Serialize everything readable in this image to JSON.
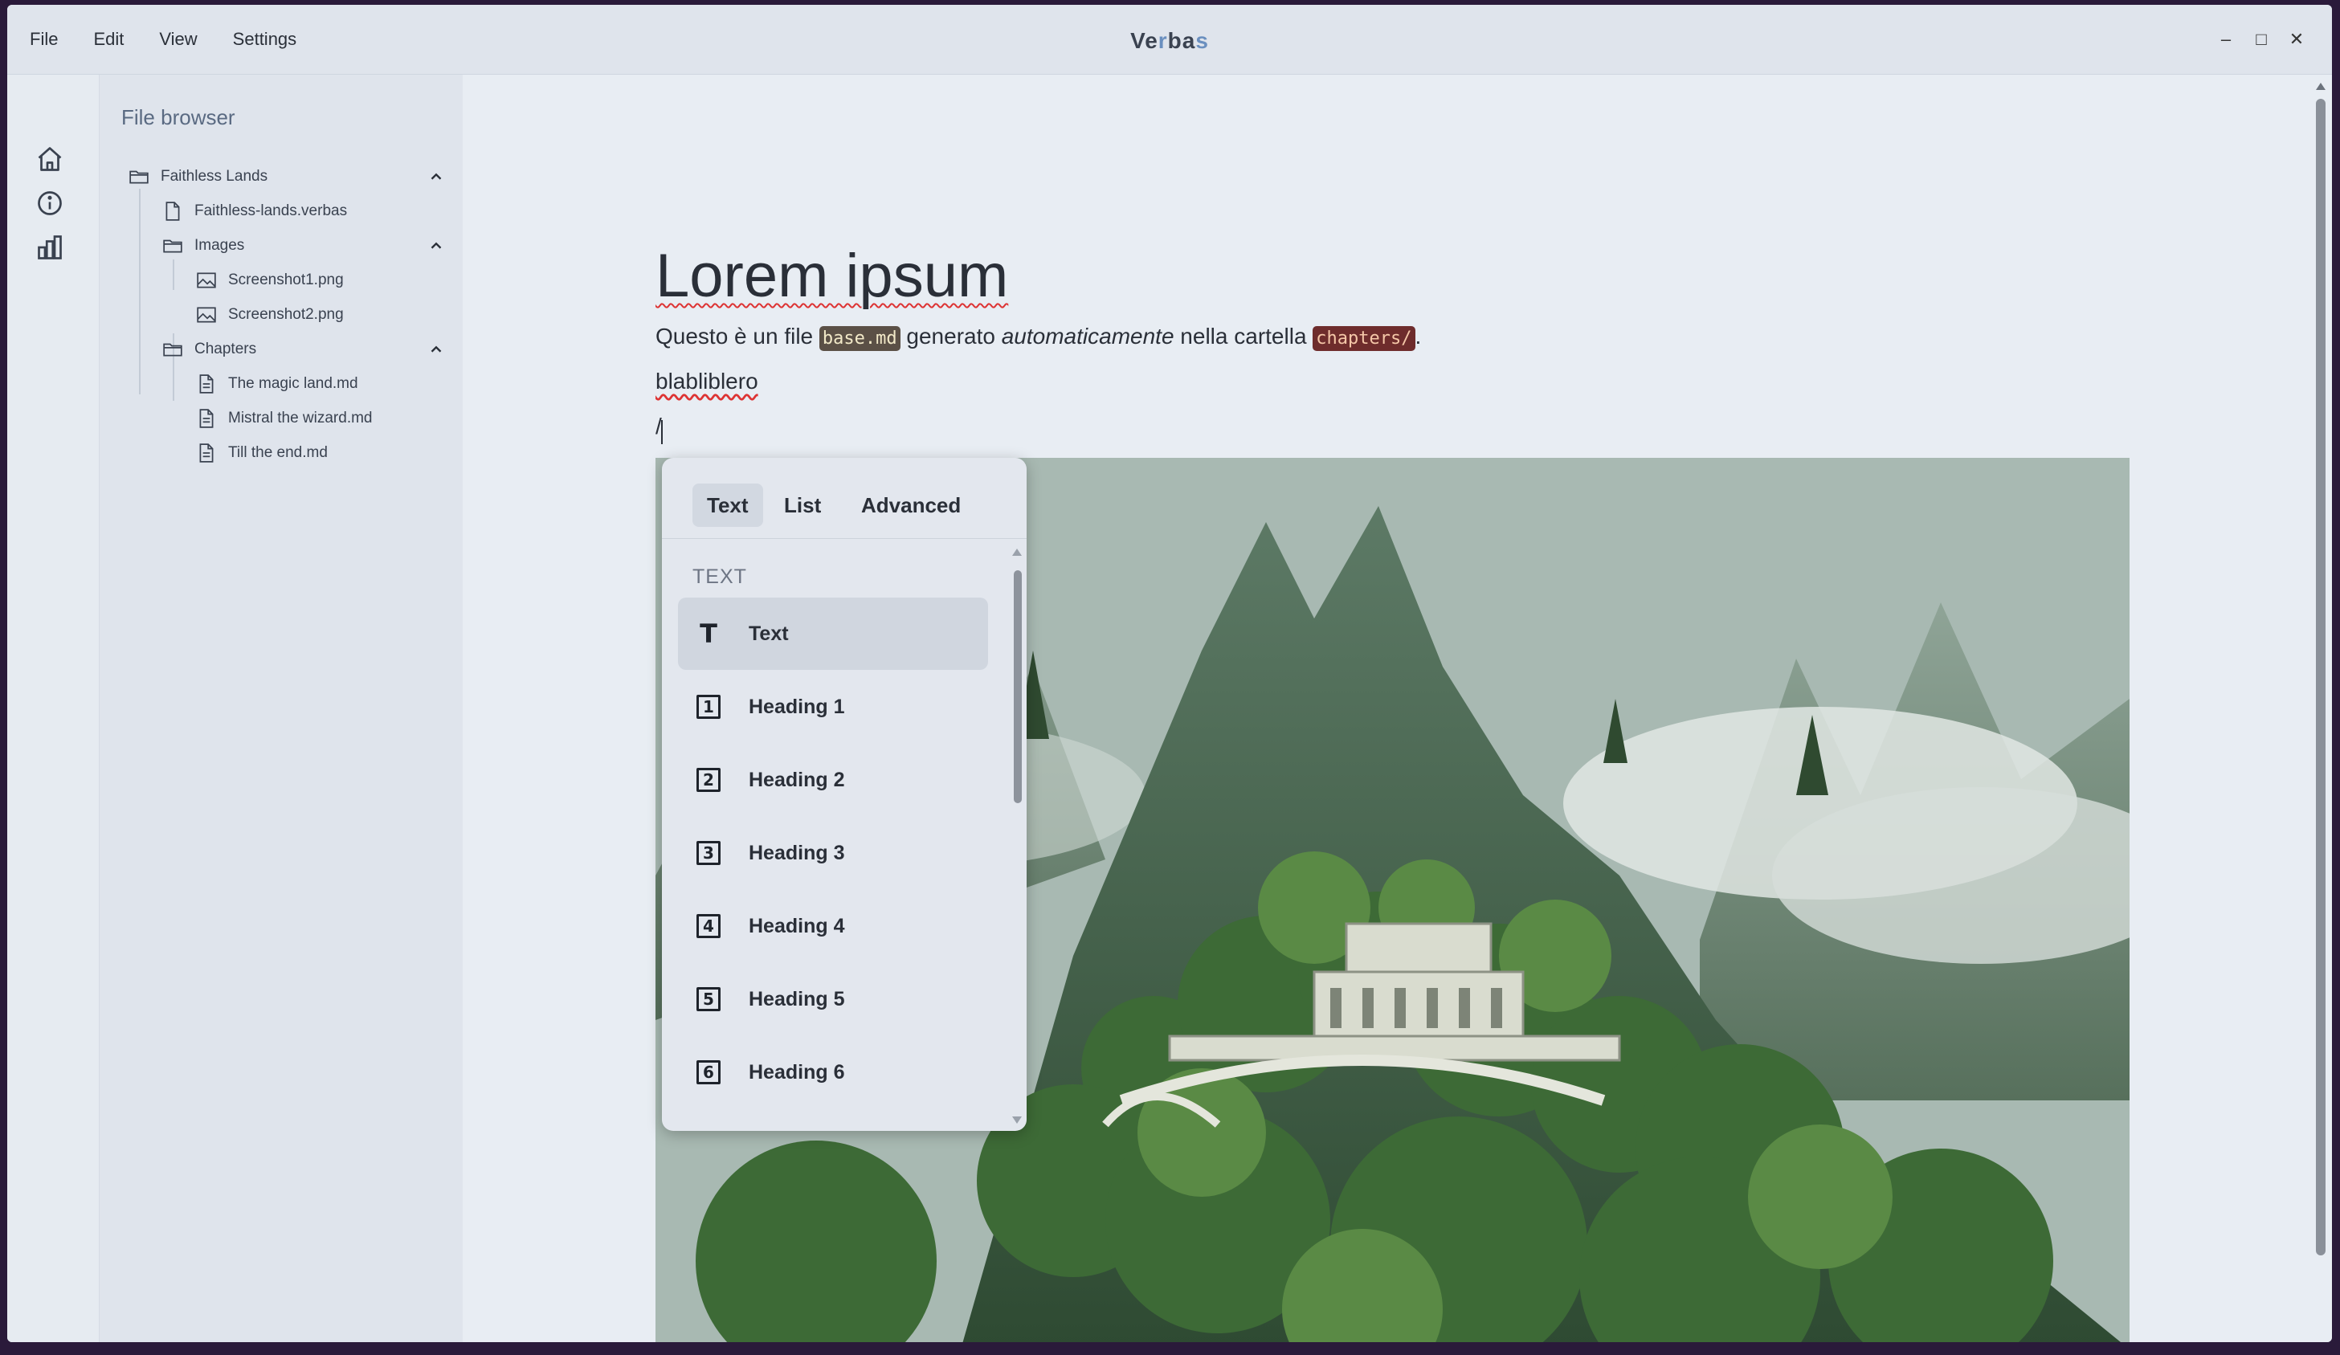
{
  "menu": [
    "File",
    "Edit",
    "View",
    "Settings"
  ],
  "app_title": {
    "part1": "Ve",
    "part2": "r",
    "part3": "ba",
    "part4": "s"
  },
  "window_controls": {
    "minimize": "–",
    "maximize": "□",
    "close": "✕"
  },
  "sidebar": {
    "title": "File browser",
    "items": [
      {
        "label": "Faithless Lands",
        "type": "folder"
      },
      {
        "label": "Faithless-lands.verbas",
        "type": "file"
      },
      {
        "label": "Images",
        "type": "folder"
      },
      {
        "label": "Screenshot1.png",
        "type": "image"
      },
      {
        "label": "Screenshot2.png",
        "type": "image"
      },
      {
        "label": "Chapters",
        "type": "folder"
      },
      {
        "label": "The magic land.md",
        "type": "doc"
      },
      {
        "label": "Mistral the wizard.md",
        "type": "doc"
      },
      {
        "label": "Till the end.md",
        "type": "doc"
      }
    ]
  },
  "document": {
    "heading": "Lorem ipsum",
    "para1": {
      "t1": "Questo è un file ",
      "code1": "base.md",
      "t2": " generato ",
      "em": "automaticamente",
      "t3": " nella cartella ",
      "code2": "chapters/",
      "t4": "."
    },
    "para2": "blabliblero",
    "slash": "/"
  },
  "popup": {
    "tabs": [
      "Text",
      "List",
      "Advanced"
    ],
    "section": "TEXT",
    "items": [
      {
        "icon": "T",
        "label": "Text"
      },
      {
        "icon": "1",
        "label": "Heading 1"
      },
      {
        "icon": "2",
        "label": "Heading 2"
      },
      {
        "icon": "3",
        "label": "Heading 3"
      },
      {
        "icon": "4",
        "label": "Heading 4"
      },
      {
        "icon": "5",
        "label": "Heading 5"
      },
      {
        "icon": "6",
        "label": "Heading 6"
      }
    ]
  },
  "colors": {
    "accent": "#6a8fbf",
    "code_bg": "#5b5046",
    "code_red_bg": "#6e2c2c"
  }
}
